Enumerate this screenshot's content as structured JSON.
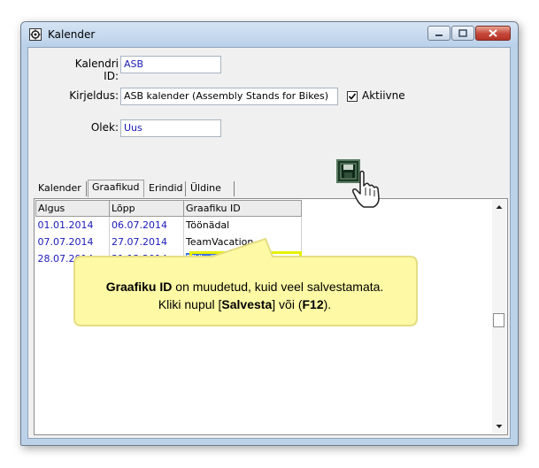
{
  "window": {
    "title": "Kalender"
  },
  "form": {
    "kalendri_id_label": "Kalendri ID:",
    "kalendri_id_value": "ASB",
    "kirjeldus_label": "Kirjeldus:",
    "kirjeldus_value": "ASB kalender (Assembly Stands for Bikes)",
    "aktiivne_label": "Aktiivne",
    "aktiivne_checked": true,
    "olek_label": "Olek:",
    "olek_value": "Uus"
  },
  "tabs": [
    {
      "label": "Kalender",
      "active": false
    },
    {
      "label": "Graafikud",
      "active": true
    },
    {
      "label": "Erindid",
      "active": false
    },
    {
      "label": "Üldine",
      "active": false
    }
  ],
  "grid": {
    "columns": [
      "Algus",
      "Lõpp",
      "Graafiku ID"
    ],
    "rows": [
      {
        "algus": "01.01.2014",
        "lopp": "06.07.2014",
        "graafiku_id": "Töönädal"
      },
      {
        "algus": "07.07.2014",
        "lopp": "27.07.2014",
        "graafiku_id": "TeamVacation"
      },
      {
        "algus": "28.07.2014",
        "lopp": "31.12.2014",
        "graafiku_id": "Töönädal"
      }
    ]
  },
  "callout": {
    "line1_bold": "Graafiku ID",
    "line1_rest": " on muudetud, kuid veel salvestamata.",
    "line2_pre": "Kliki nupul [",
    "line2_bold1": "Salvesta",
    "line2_mid": "] või (",
    "line2_bold2": "F12",
    "line2_post": ")."
  },
  "colors": {
    "field_text": "#1a1ab8",
    "selection": "#3a6ee6",
    "highlight_border": "#e8f000",
    "callout_fill": "#fdf9a4",
    "callout_border": "#e5dd84"
  },
  "icons": {
    "app": "calendar-gear-icon",
    "save": "floppy-disk-save-icon",
    "cursor": "hand-pointer-icon"
  }
}
